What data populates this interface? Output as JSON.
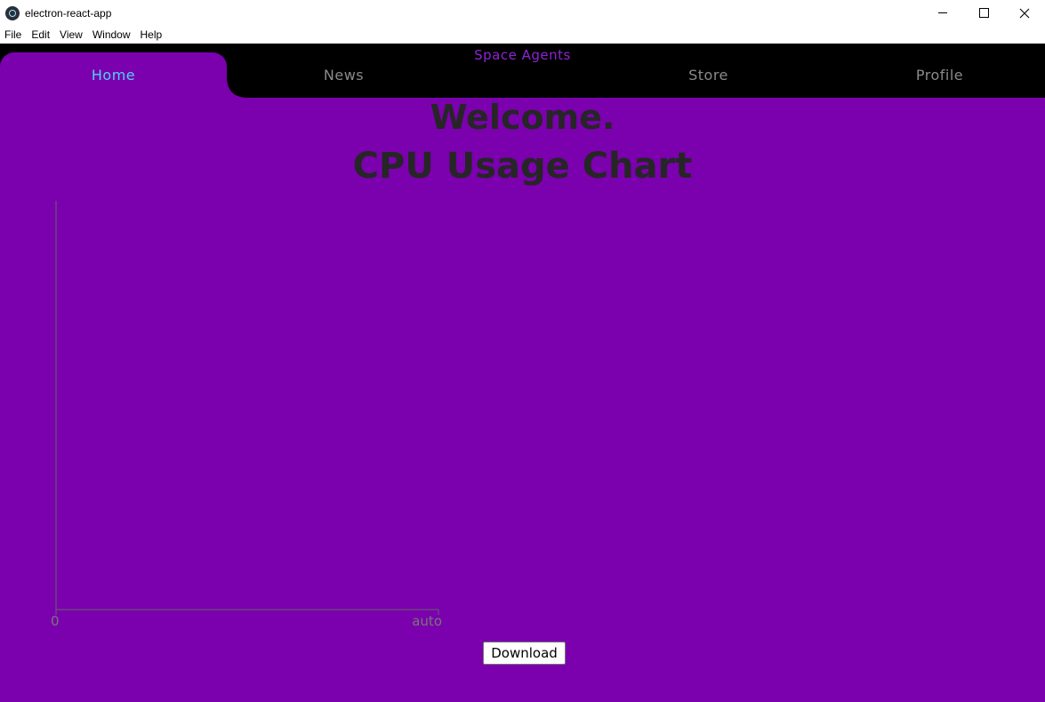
{
  "window": {
    "title": "electron-react-app"
  },
  "menu": {
    "items": [
      "File",
      "Edit",
      "View",
      "Window",
      "Help"
    ]
  },
  "nav": {
    "brand": "Space Agents",
    "tabs": [
      "Home",
      "News",
      "Store",
      "Profile"
    ],
    "active_tab": "Home"
  },
  "colors": {
    "background": "#7b00ae",
    "active_tab_text": "#4fd2f2",
    "brand_text": "#8f23d6",
    "nav_background": "#000000"
  },
  "main": {
    "welcome": "Welcome.",
    "chart_heading": "CPU Usage Chart",
    "download_label": "Download"
  },
  "chart_data": {
    "type": "line",
    "series": [],
    "x_tick_labels": [
      "0",
      "auto"
    ],
    "grid": false
  }
}
